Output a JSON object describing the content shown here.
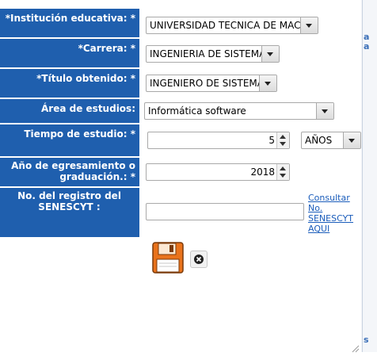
{
  "fields": {
    "institucion": {
      "label": "*Institución educativa:  *",
      "value": "UNIVERSIDAD TECNICA DE MACH"
    },
    "carrera": {
      "label": "*Carrera: *",
      "value": "INGENIERIA DE SISTEMA"
    },
    "titulo": {
      "label": "*Título obtenido:  *",
      "value": "INGENIERO DE SISTEMA"
    },
    "area": {
      "label": "Área de estudios:",
      "value": "Informática software"
    },
    "tiempo": {
      "label": "Tiempo de estudio:  *",
      "value": "5",
      "unit": "AÑOS"
    },
    "anio": {
      "label_line1": "Año de egresamiento o",
      "label_line2": "graduación.:  *",
      "value": "2018"
    },
    "senescyt": {
      "label_line1": "No. del registro del",
      "label_line2": "SENESCYT :",
      "value": "",
      "link_lines": [
        "Consultar",
        "No.",
        "SENESCYT",
        "AQUI"
      ]
    }
  },
  "actions": {
    "save_icon": "floppy-disk-icon",
    "cancel_icon": "close-icon"
  },
  "right_edge": {
    "letters": [
      "a",
      "a",
      "s"
    ]
  },
  "colors": {
    "label_bg": "#1f5fae",
    "link": "#1b5dbb",
    "save_orange": "#e9731c"
  }
}
